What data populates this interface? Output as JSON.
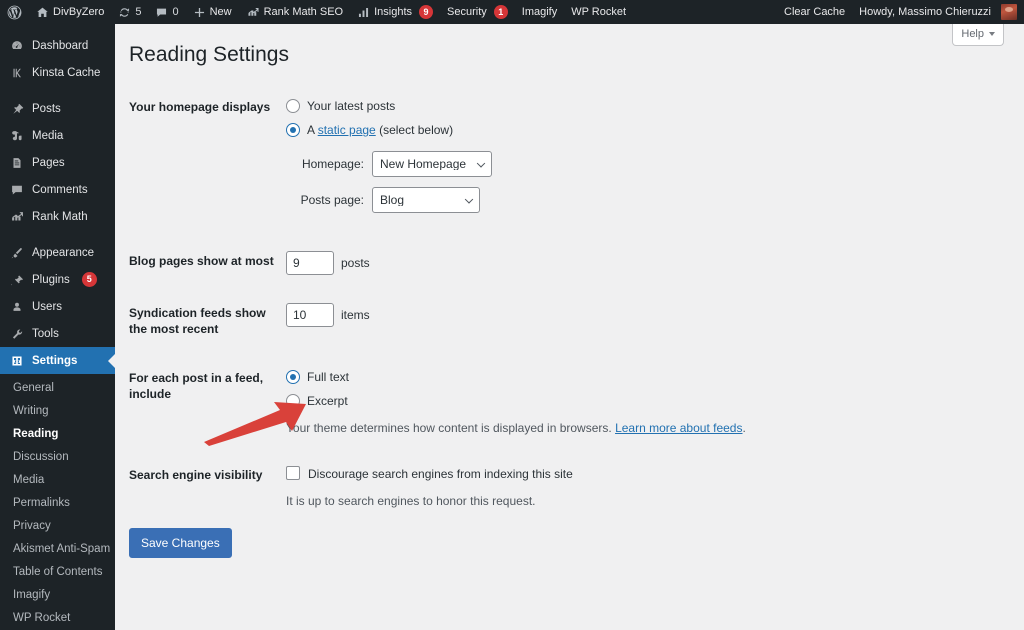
{
  "adminbar": {
    "left_items": [
      {
        "name": "wp-logo",
        "icon": "wordpress-icon",
        "label": ""
      },
      {
        "name": "site-name",
        "icon": "home-icon",
        "label": "DivByZero"
      },
      {
        "name": "updates",
        "icon": "updates-icon",
        "label": "5"
      },
      {
        "name": "comments",
        "icon": "comment-icon",
        "label": "0"
      },
      {
        "name": "new-content",
        "icon": "plus-icon",
        "label": "New"
      },
      {
        "name": "rank-math-seo",
        "icon": "rank-math-icon",
        "label": "Rank Math SEO"
      },
      {
        "name": "insights",
        "icon": "chart-bars-icon",
        "label": "Insights",
        "badge": "9"
      },
      {
        "name": "security",
        "icon": "",
        "label": "Security",
        "badge": "1"
      },
      {
        "name": "imagify",
        "icon": "",
        "label": "Imagify"
      },
      {
        "name": "wp-rocket",
        "icon": "",
        "label": "WP Rocket"
      }
    ],
    "right_items": [
      {
        "name": "clear-cache",
        "label": "Clear Cache"
      },
      {
        "name": "my-account",
        "label": "Howdy, Massimo Chieruzzi"
      }
    ]
  },
  "sidebar": {
    "top_items": [
      {
        "label": "Dashboard",
        "icon": "dashboard-icon",
        "current": false,
        "badge": ""
      },
      {
        "label": "Kinsta Cache",
        "icon": "kinsta-icon",
        "current": false,
        "badge": ""
      },
      {
        "sep": true
      },
      {
        "label": "Posts",
        "icon": "pin-icon",
        "current": false,
        "badge": ""
      },
      {
        "label": "Media",
        "icon": "media-icon",
        "current": false,
        "badge": ""
      },
      {
        "label": "Pages",
        "icon": "pages-icon",
        "current": false,
        "badge": ""
      },
      {
        "label": "Comments",
        "icon": "comment-icon",
        "current": false,
        "badge": ""
      },
      {
        "label": "Rank Math",
        "icon": "rank-math-icon",
        "current": false,
        "badge": ""
      },
      {
        "sep": true
      },
      {
        "label": "Appearance",
        "icon": "brush-icon",
        "current": false,
        "badge": ""
      },
      {
        "label": "Plugins",
        "icon": "plug-icon",
        "current": false,
        "badge": "5"
      },
      {
        "label": "Users",
        "icon": "users-icon",
        "current": false,
        "badge": ""
      },
      {
        "label": "Tools",
        "icon": "wrench-icon",
        "current": false,
        "badge": ""
      },
      {
        "label": "Settings",
        "icon": "settings-icon",
        "current": true,
        "badge": ""
      }
    ],
    "submenu_items": [
      {
        "label": "General",
        "current": false
      },
      {
        "label": "Writing",
        "current": false
      },
      {
        "label": "Reading",
        "current": true
      },
      {
        "label": "Discussion",
        "current": false
      },
      {
        "label": "Media",
        "current": false
      },
      {
        "label": "Permalinks",
        "current": false
      },
      {
        "label": "Privacy",
        "current": false
      },
      {
        "label": "Akismet Anti-Spam",
        "current": false
      },
      {
        "label": "Table of Contents",
        "current": false
      },
      {
        "label": "Imagify",
        "current": false
      },
      {
        "label": "WP Rocket",
        "current": false
      }
    ]
  },
  "screen_meta": {
    "help_label": "Help"
  },
  "page": {
    "title": "Reading Settings"
  },
  "settings": {
    "homepage_displays": {
      "label": "Your homepage displays",
      "option_latest_posts": "Your latest posts",
      "option_static_prefix": "A ",
      "option_static_link": "static page",
      "option_static_suffix": " (select below)",
      "selected": "static_page",
      "homepage_label": "Homepage:",
      "homepage_value": "New Homepage",
      "posts_page_label": "Posts page:",
      "posts_page_value": "Blog"
    },
    "blog_pages": {
      "label": "Blog pages show at most",
      "value": "9",
      "unit": "posts"
    },
    "syndication_feeds": {
      "label": "Syndication feeds show the most recent",
      "value": "10",
      "unit": "items"
    },
    "feed_include": {
      "label": "For each post in a feed, include",
      "option_full_text": "Full text",
      "option_excerpt": "Excerpt",
      "selected": "full_text",
      "description_text": "Your theme determines how content is displayed in browsers. ",
      "description_link": "Learn more about feeds",
      "description_end": "."
    },
    "search_engine_visibility": {
      "label": "Search engine visibility",
      "checkbox_label": "Discourage search engines from indexing this site",
      "checked": false,
      "description": "It is up to search engines to honor this request."
    },
    "submit_label": "Save Changes"
  },
  "annotation": {
    "name": "red-arrow-pointing-to-discourage-checkbox",
    "color": "#d9413a"
  },
  "colors": {
    "accent_blue": "#2271b1",
    "button_blue": "#3a6fb5",
    "badge_red": "#d63638",
    "admin_dark": "#1d2327",
    "content_bg": "#f0f0f1",
    "arrow_red": "#d9413a"
  }
}
